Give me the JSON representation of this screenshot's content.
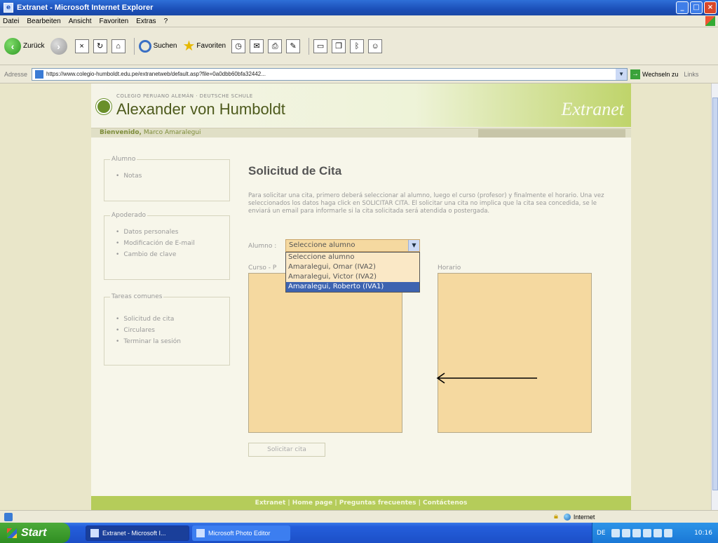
{
  "window": {
    "title": "Extranet - Microsoft Internet Explorer"
  },
  "menu": [
    "Datei",
    "Bearbeiten",
    "Ansicht",
    "Favoriten",
    "Extras",
    "?"
  ],
  "toolbar": {
    "back_label": "Zurück",
    "search_label": "Suchen",
    "favorites_label": "Favoriten"
  },
  "address": {
    "label": "Adresse",
    "url": "https://www.colegio-humboldt.edu.pe/extranetweb/default.asp?file=0a0dbb60bfa32442...",
    "go_label": "Wechseln zu",
    "links_label": "Links"
  },
  "site": {
    "school_subtitle": "COLEGIO PERUANO ALEMÁN · DEUTSCHE SCHULE",
    "school_name": "Alexander von Humboldt",
    "brand": "Extranet",
    "welcome_prefix": "Bienvenido,",
    "welcome_name": "Marco Amaralegui"
  },
  "sidebar": {
    "alumno": {
      "legend": "Alumno",
      "items": [
        "Notas"
      ]
    },
    "apoderado": {
      "legend": "Apoderado",
      "items": [
        "Datos personales",
        "Modificación de E-mail",
        "Cambio de clave"
      ]
    },
    "tareas": {
      "legend": "Tareas comunes",
      "items": [
        "Solicitud de cita",
        "Circulares",
        "Terminar la sesión"
      ]
    }
  },
  "main": {
    "title": "Solicitud de Cita",
    "intro": "Para solicitar una cita, primero deberá seleccionar al alumno, luego el curso (profesor) y finalmente el horario. Una vez seleccionados los datos haga click en SOLICITAR CITA. El solicitar una cita no implica que la cita sea concedida, se le enviará un email para informarle si la cita solicitada será atendida o postergada.",
    "alumno_label": "Alumno :",
    "alumno_selected": "Seleccione alumno",
    "alumno_options": [
      "Seleccione alumno",
      "Amaralegui, Omar (IVA2)",
      "Amaralegui, Victor (IVA2)",
      "Amaralegui, Roberto (IVA1)"
    ],
    "highlighted_index": 3,
    "curso_label": "Curso - P",
    "horario_label": "Horario",
    "submit_label": "Solicitar cita"
  },
  "footer": {
    "text": "Extranet | Home page | Preguntas frecuentes | Contáctenos"
  },
  "status": {
    "zone": "Internet"
  },
  "taskbar": {
    "start": "Start",
    "tasks": [
      "Extranet - Microsoft I...",
      "Microsoft Photo Editor"
    ],
    "clock": "10:16"
  }
}
